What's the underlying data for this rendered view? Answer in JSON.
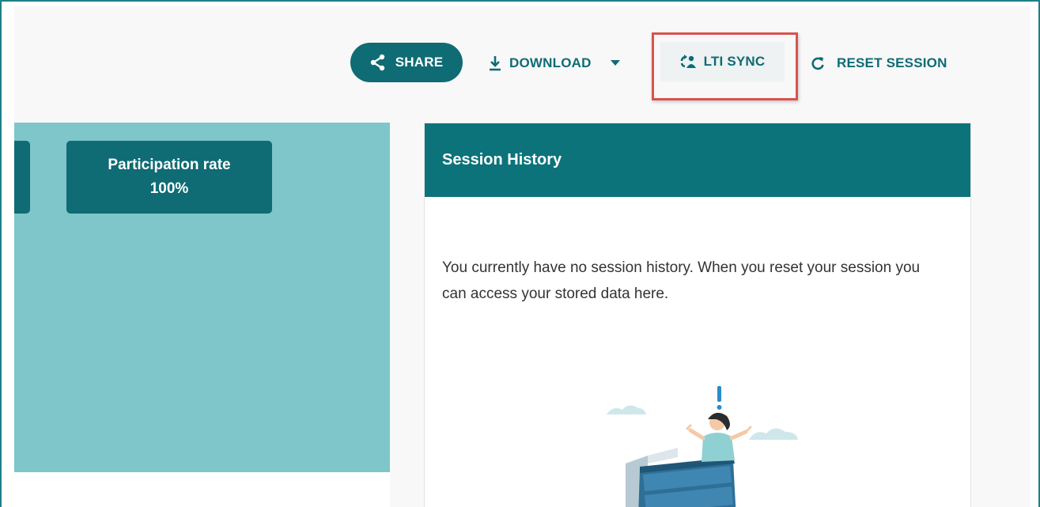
{
  "toolbar": {
    "share_label": "SHARE",
    "download_label": "DOWNLOAD",
    "lti_sync_label": "LTI SYNC",
    "reset_label": "RESET SESSION"
  },
  "stats": {
    "participation": {
      "label": "Participation rate",
      "value": "100%"
    }
  },
  "session_history": {
    "title": "Session History",
    "empty_message": "You currently have no session history. When you reset your session you can access your stored data here."
  },
  "colors": {
    "brand_teal": "#0f6b74",
    "panel_teal": "#7ec6c9",
    "highlight_red": "#d9534f"
  },
  "icons": {
    "share": "share-icon",
    "download": "download-icon",
    "dropdown": "caret-down-icon",
    "lti_sync": "lti-sync-icon",
    "reset": "refresh-icon"
  }
}
